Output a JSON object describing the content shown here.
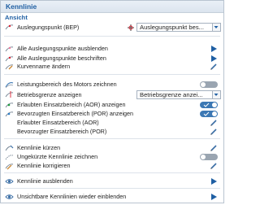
{
  "panel": {
    "title": "Kennlinie",
    "section_view": "Ansicht"
  },
  "design_point": {
    "label": "Auslegungspunkt (BEP)",
    "combo_value": "Auslegungspunkt bes..."
  },
  "items": {
    "hide_points": "Alle Auslegungspunkte ausblenden",
    "label_points": "Alle Auslegungspunkte beschriften",
    "rename_curve": "Kurvenname ändern",
    "motor_range": "Leistungsbereich des Motors zeichnen",
    "operating_limit": "Betriebsgrenze anzeigen",
    "operating_limit_value": "Betriebsgrenze anzei...",
    "aor_show": "Erlaubten Einsatzbereich (AOR) anzeigen",
    "por_show": "Bevorzugten Einsatzbereich (POR) anzeigen",
    "aor": "Erlaubter Einsatzbereich (AOR)",
    "por": "Bevorzugter Einsatzbereich (POR)",
    "shorten_curve": "Kennlinie kürzen",
    "draw_unshortened": "Ungekürzte Kennlinie zeichnen",
    "correct_curve": "Kennlinie korrigieren",
    "hide_curve": "Kennlinie ausblenden",
    "show_hidden": "Unsichtbare Kennlinien wieder einblenden"
  },
  "colors": {
    "accent": "#1f5fa3",
    "toggle_on": "#3c78b4",
    "toggle_off": "#9aa5b1"
  }
}
